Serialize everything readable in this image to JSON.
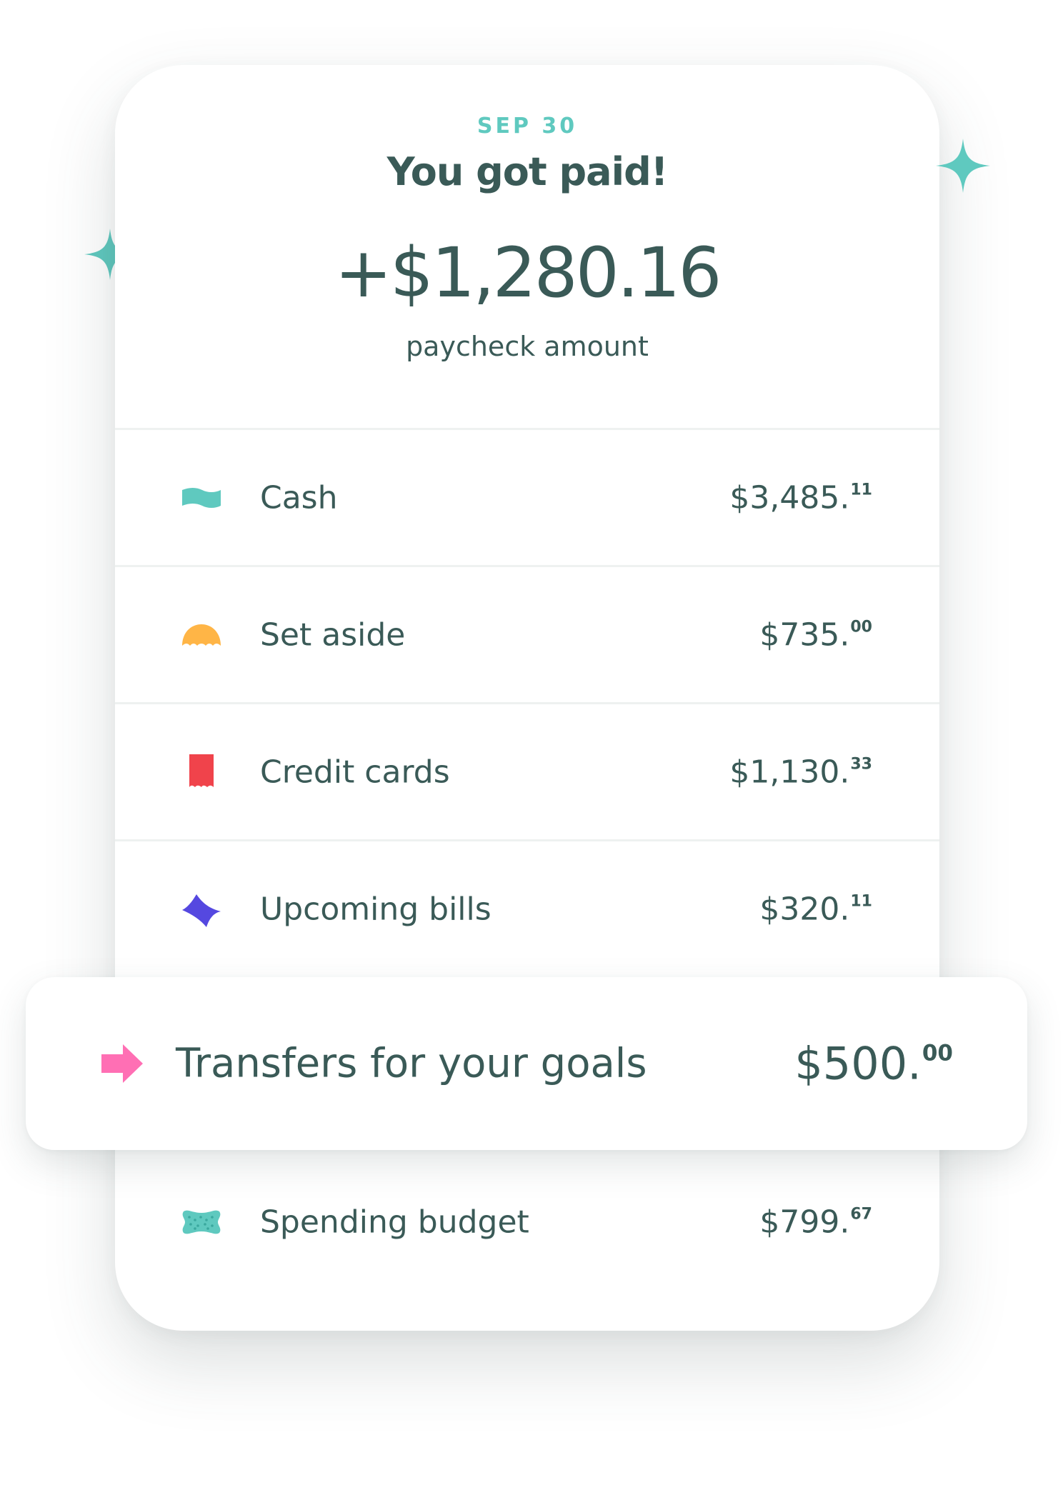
{
  "paycheck": {
    "date": "SEP 30",
    "title": "You got paid!",
    "amount": "+$1,280.16",
    "subtitle": "paycheck amount"
  },
  "rows": [
    {
      "label": "Cash",
      "value_main": "$3,485.",
      "value_cents": "11",
      "icon": "cash-bill-icon",
      "color": "#5fc9bf"
    },
    {
      "label": "Set aside",
      "value_main": "$735.",
      "value_cents": "00",
      "icon": "umbrella-icon",
      "color": "#ffb546"
    },
    {
      "label": "Credit cards",
      "value_main": "$1,130.",
      "value_cents": "33",
      "icon": "receipt-icon",
      "color": "#f0434b"
    },
    {
      "label": "Upcoming bills",
      "value_main": "$320.",
      "value_cents": "11",
      "icon": "diamond-wave-icon",
      "color": "#5548e0"
    }
  ],
  "highlight": {
    "label": "Transfers for your goals",
    "value_main": "$500.",
    "value_cents": "00",
    "icon": "arrow-right-icon",
    "color": "#ff6fb4"
  },
  "spending": {
    "label": "Spending budget",
    "value_main": "$799.",
    "value_cents": "67",
    "icon": "bone-pattern-icon",
    "color": "#5fc9bf"
  },
  "decoration": {
    "sparkle_color": "#5fc9bf",
    "doodle_color": "#3a5a57"
  }
}
